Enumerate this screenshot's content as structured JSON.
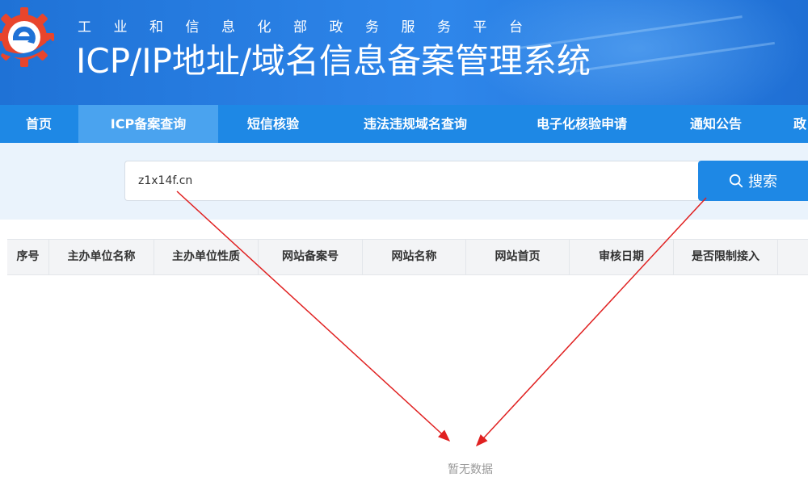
{
  "header": {
    "subtitle": "工业和信息化部政务服务平台",
    "title": "ICP/IP地址/域名信息备案管理系统"
  },
  "nav": {
    "items": [
      {
        "label": "首页"
      },
      {
        "label": "ICP备案查询",
        "active": true
      },
      {
        "label": "短信核验"
      },
      {
        "label": "违法违规域名查询"
      },
      {
        "label": "电子化核验申请"
      },
      {
        "label": "通知公告"
      },
      {
        "label": "政"
      }
    ]
  },
  "search": {
    "value": "z1x14f.cn",
    "button_label": "搜索",
    "icon": "search-icon"
  },
  "table": {
    "columns": [
      "序号",
      "主办单位名称",
      "主办单位性质",
      "网站备案号",
      "网站名称",
      "网站首页",
      "审核日期",
      "是否限制接入"
    ],
    "empty_text": "暂无数据"
  },
  "colors": {
    "header_blue": "#1f72d6",
    "nav_blue": "#1e88e5",
    "nav_active": "#4aa3ef",
    "arrow_red": "#e02020"
  }
}
